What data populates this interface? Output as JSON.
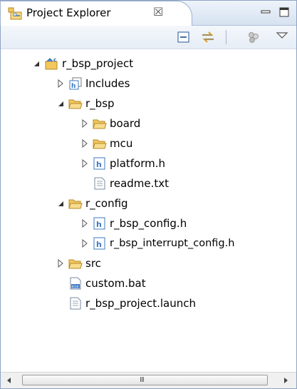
{
  "view": {
    "title": "Project Explorer",
    "close_symbol": "☒",
    "icon": "project-explorer-icon"
  },
  "toolbar": {
    "buttons": [
      "collapse-all-icon",
      "link-with-editor-icon",
      "focus-icon",
      "view-menu-icon"
    ]
  },
  "tree": [
    {
      "label": "r_bsp_project",
      "icon": "c-project-icon",
      "state": "expanded"
    },
    {
      "label": "Includes",
      "icon": "includes-icon",
      "state": "collapsed"
    },
    {
      "label": "r_bsp",
      "icon": "folder-icon",
      "state": "expanded"
    },
    {
      "label": "board",
      "icon": "folder-icon",
      "state": "collapsed"
    },
    {
      "label": "mcu",
      "icon": "folder-icon",
      "state": "collapsed"
    },
    {
      "label": "platform.h",
      "icon": "header-file-icon",
      "state": "collapsed"
    },
    {
      "label": "readme.txt",
      "icon": "text-file-icon",
      "state": "none"
    },
    {
      "label": "r_config",
      "icon": "folder-icon",
      "state": "expanded"
    },
    {
      "label": "r_bsp_config.h",
      "icon": "header-file-icon",
      "state": "collapsed"
    },
    {
      "label": "r_bsp_interrupt_config.h",
      "icon": "header-file-icon",
      "state": "collapsed"
    },
    {
      "label": "src",
      "icon": "folder-icon",
      "state": "collapsed"
    },
    {
      "label": "custom.bat",
      "icon": "batch-file-icon",
      "state": "none"
    },
    {
      "label": "r_bsp_project.launch",
      "icon": "text-file-icon",
      "state": "none"
    }
  ],
  "scrollbar": {
    "grip": "III"
  },
  "colors": {
    "accent": "#3d79c2",
    "folder": "#f3c75c",
    "border": "#8ea4c3"
  }
}
